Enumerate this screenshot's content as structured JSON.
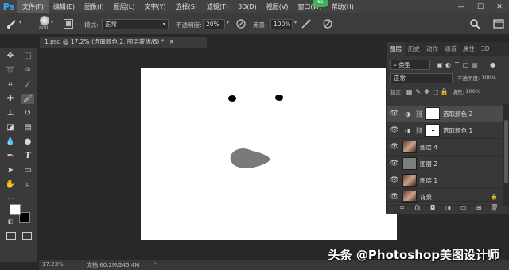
{
  "app": {
    "logo": "Ps"
  },
  "menu": [
    "文件(F)",
    "编辑(E)",
    "图像(I)",
    "图层(L)",
    "文字(Y)",
    "选择(S)",
    "滤镜(T)",
    "3D(D)",
    "视图(V)",
    "窗口(W)",
    "帮助(H)"
  ],
  "notification_badge": "61",
  "window_controls": {
    "minimize": "—",
    "maximize": "☐",
    "close": "✕"
  },
  "options": {
    "brush_size": "800",
    "mode_label": "模式:",
    "mode_value": "正常",
    "opacity_label": "不透明度:",
    "opacity_value": "20%",
    "flow_label": "流量:",
    "flow_value": "100%"
  },
  "document_tab": {
    "title": "1.psd @ 17.2% (选取颜色 2, 图层蒙版/8) *",
    "close": "×"
  },
  "status": {
    "zoom": "17.23%",
    "doc_info": "文档:60.2M/245.4M",
    "arrow": "›"
  },
  "panel": {
    "tabs": [
      "图层",
      "历史",
      "动作",
      "通道",
      "属性",
      "3D"
    ],
    "filter_label": "类型",
    "blend_mode": "正常",
    "opacity_label": "不透明度:",
    "opacity_value": "100%",
    "lock_label": "锁定:",
    "fill_label": "填充:",
    "fill_value": "100%"
  },
  "layers": [
    {
      "name": "选取颜色 2",
      "type": "adjustment",
      "selected": true
    },
    {
      "name": "选取颜色 1",
      "type": "adjustment",
      "selected": false
    },
    {
      "name": "图层 4",
      "type": "photo",
      "selected": false
    },
    {
      "name": "图层 2",
      "type": "gray",
      "selected": false
    },
    {
      "name": "图层 1",
      "type": "photo",
      "selected": false
    },
    {
      "name": "背景",
      "type": "photo",
      "locked": true,
      "selected": false
    }
  ],
  "panel_footer": [
    "∞",
    "fx",
    "◘",
    "◑",
    "▭",
    "⊞",
    "🗑"
  ],
  "watermark": "头条 @Photoshop美图设计师",
  "colors": {
    "accent": "#31a8ff",
    "badge": "#3db45b",
    "canvas": "#ffffff",
    "shape": "#7a7a7a"
  }
}
